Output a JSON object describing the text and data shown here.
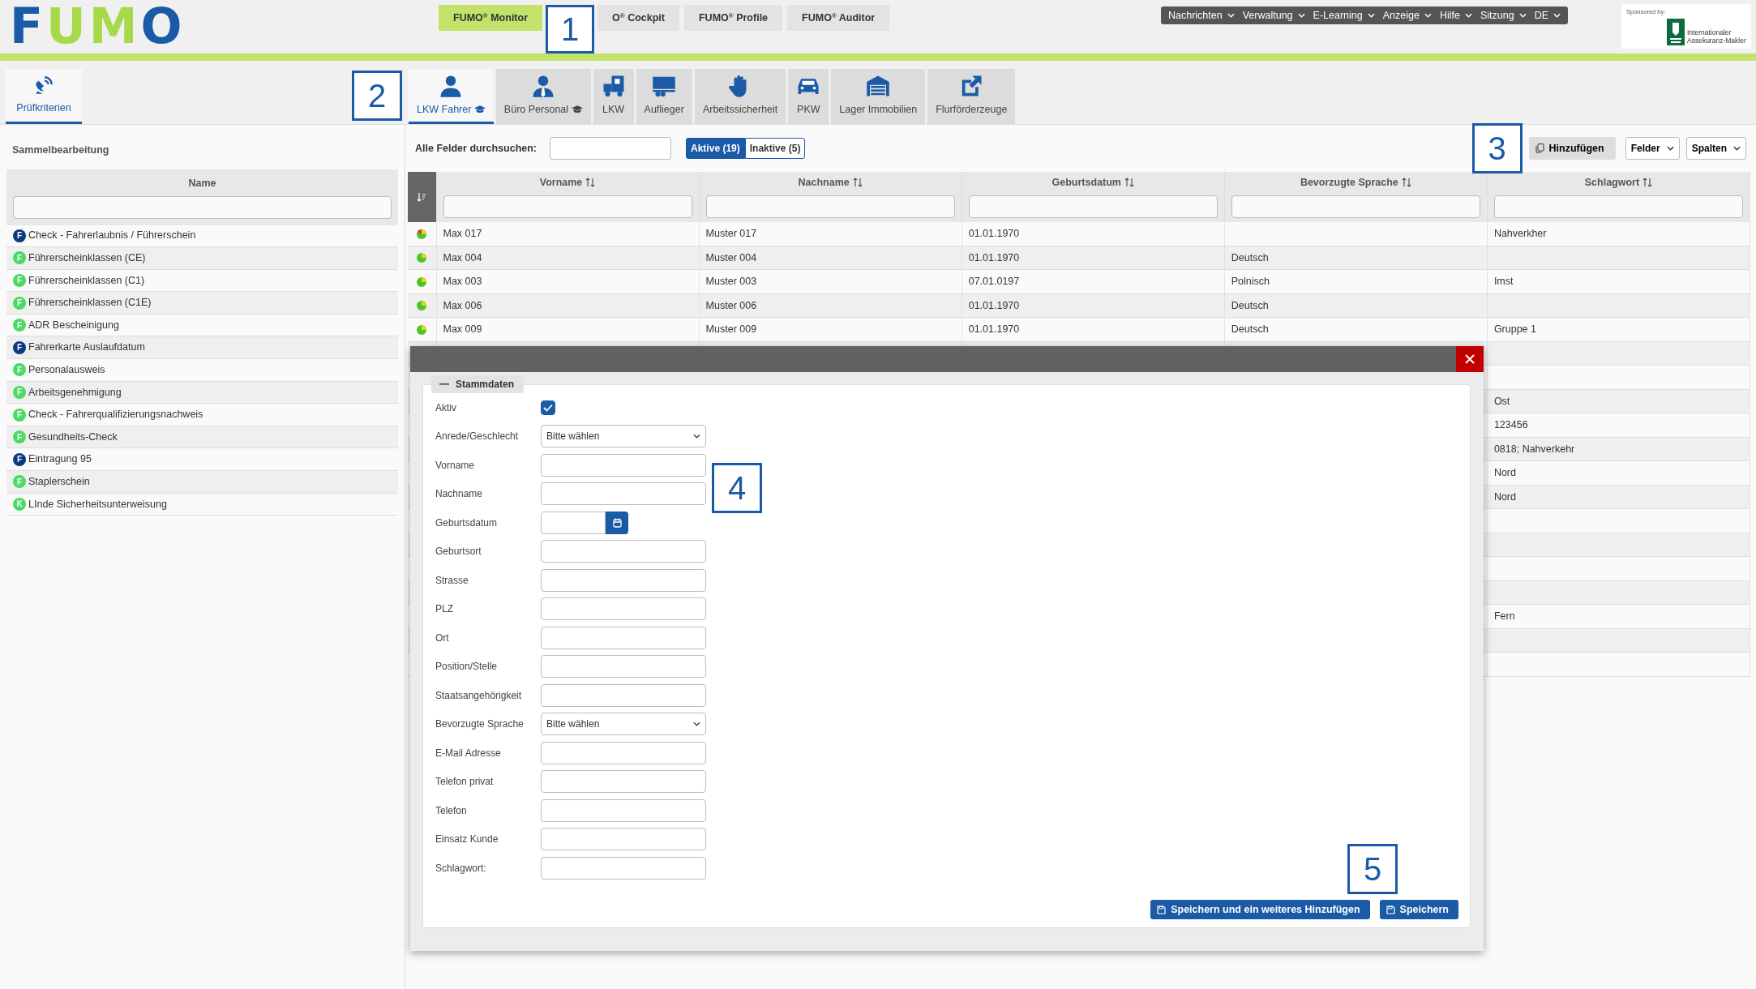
{
  "logo": "FUMO",
  "top_tabs": [
    {
      "label": "FUMO$^{®}$ Monitor",
      "selected": true
    },
    {
      "label": "O$^{®}$ Cockpit",
      "selected": false
    },
    {
      "label": "FUMO$^{®}$ Profile",
      "selected": false
    },
    {
      "label": "FUMO$^{®}$ Auditor",
      "selected": false
    }
  ],
  "menu": [
    "Nachrichten",
    "Verwaltung",
    "E-Learning",
    "Anzeige",
    "Hilfe",
    "Sitzung",
    "DE"
  ],
  "sponsor": {
    "caption": "Sponsored by:",
    "tagline": "Internationaler Assekuranz-Makler"
  },
  "callouts": [
    "1",
    "2",
    "3",
    "4",
    "5"
  ],
  "side_tabs": [
    {
      "label": "Prüfkriterien",
      "selected": true
    }
  ],
  "module_tabs": [
    {
      "label": "LKW Fahrer",
      "cap": true,
      "selected": true
    },
    {
      "label": "Büro Personal",
      "cap": true,
      "selected": false
    },
    {
      "label": "LKW",
      "cap": false,
      "selected": false
    },
    {
      "label": "Auflieger",
      "cap": false,
      "selected": false
    },
    {
      "label": "Arbeitssicherheit",
      "cap": false,
      "selected": false
    },
    {
      "label": "PKW",
      "cap": false,
      "selected": false
    },
    {
      "label": "Lager Immobilien",
      "cap": false,
      "selected": false
    },
    {
      "label": "Flurförderzeuge",
      "cap": false,
      "selected": false
    }
  ],
  "sidebar": {
    "title": "Sammelbearbeitung",
    "column": "Name",
    "items": [
      {
        "badge": "F",
        "color": "#0b3a82",
        "label": "Check - Fahrerlaubnis / Führerschein"
      },
      {
        "badge": "F",
        "color": "#4cd964",
        "label": "Führerscheinklassen (CE)"
      },
      {
        "badge": "F",
        "color": "#4cd964",
        "label": "Führerscheinklassen (C1)"
      },
      {
        "badge": "F",
        "color": "#4cd964",
        "label": "Führerscheinklassen (C1E)"
      },
      {
        "badge": "F",
        "color": "#4cd964",
        "label": "ADR Bescheinigung"
      },
      {
        "badge": "F",
        "color": "#0b3a82",
        "label": "Fahrerkarte Auslaufdatum"
      },
      {
        "badge": "F",
        "color": "#4cd964",
        "label": "Personalausweis"
      },
      {
        "badge": "F",
        "color": "#4cd964",
        "label": "Arbeitsgenehmigung"
      },
      {
        "badge": "F",
        "color": "#4cd964",
        "label": "Check - Fahrerqualifizierungsnachweis"
      },
      {
        "badge": "F",
        "color": "#4cd964",
        "label": "Gesundheits-Check"
      },
      {
        "badge": "F",
        "color": "#0b3a82",
        "label": "Eintragung 95"
      },
      {
        "badge": "F",
        "color": "#4cd964",
        "label": "Staplerschein"
      },
      {
        "badge": "K",
        "color": "#4cd964",
        "label": "LInde Sicherheitsunterweisung"
      }
    ]
  },
  "toolbar": {
    "search_label": "Alle Felder durchsuchen:",
    "filters": [
      {
        "label": "Aktive (19)",
        "selected": true
      },
      {
        "label": "Inaktive (5)",
        "selected": false
      }
    ],
    "buttons": [
      {
        "label": "Hinzufügen",
        "kind": "add"
      },
      {
        "label": "Felder",
        "kind": "dropdown"
      },
      {
        "label": "Spalten",
        "kind": "dropdown"
      }
    ]
  },
  "table": {
    "columns": [
      "Vorname",
      "Nachname",
      "Geburtsdatum",
      "Bevorzugte Sprache",
      "Schlagwort"
    ],
    "rows": [
      {
        "kind": "warning",
        "cells": [
          "Max 017",
          "Muster 017",
          "01.01.1970",
          "",
          "Nahverkher"
        ]
      },
      {
        "kind": "ok",
        "cells": [
          "Max 004",
          "Muster 004",
          "01.01.1970",
          "Deutsch",
          ""
        ]
      },
      {
        "kind": "ok",
        "cells": [
          "Max 003",
          "Muster 003",
          "07.01.0197",
          "Polnisch",
          "Imst"
        ]
      },
      {
        "kind": "ok",
        "cells": [
          "Max 006",
          "Muster 006",
          "01.01.1970",
          "Deutsch",
          ""
        ]
      },
      {
        "kind": "ok",
        "cells": [
          "Max 009",
          "Muster 009",
          "01.01.1970",
          "Deutsch",
          "Gruppe 1"
        ]
      },
      {
        "cells": [
          ""
        ]
      },
      {
        "cells": [
          ""
        ]
      },
      {
        "cells": [
          "Ost"
        ]
      },
      {
        "cells": [
          "123456"
        ]
      },
      {
        "cells": [
          "0818; Nahverkehr"
        ]
      },
      {
        "cells": [
          "Nord"
        ]
      },
      {
        "cells": [
          "Nord"
        ]
      },
      {
        "cells": [
          ""
        ]
      },
      {
        "cells": [
          ""
        ]
      },
      {
        "cells": [
          ""
        ]
      },
      {
        "cells": [
          ""
        ]
      },
      {
        "cells": [
          "Fern"
        ]
      },
      {
        "cells": [
          ""
        ]
      },
      {
        "cells": [
          ""
        ]
      }
    ]
  },
  "modal": {
    "legend": "Stammdaten",
    "fields": [
      {
        "label": "Aktiv",
        "kind": "checkbox",
        "checked": true
      },
      {
        "label": "Anrede/Geschlecht",
        "kind": "select",
        "value": "Bitte wählen"
      },
      {
        "label": "Vorname",
        "kind": "text"
      },
      {
        "label": "Nachname",
        "kind": "text"
      },
      {
        "label": "Geburtsdatum",
        "kind": "date"
      },
      {
        "label": "Geburtsort",
        "kind": "text"
      },
      {
        "label": "Strasse",
        "kind": "text"
      },
      {
        "label": "PLZ",
        "kind": "text"
      },
      {
        "label": "Ort",
        "kind": "text"
      },
      {
        "label": "Position/Stelle",
        "kind": "text"
      },
      {
        "label": "Staatsangehörigkeit",
        "kind": "text"
      },
      {
        "label": "Bevorzugte Sprache",
        "kind": "select",
        "value": "Bitte wählen"
      },
      {
        "label": "E-Mail Adresse",
        "kind": "text"
      },
      {
        "label": "Telefon privat",
        "kind": "text"
      },
      {
        "label": "Telefon",
        "kind": "text"
      },
      {
        "label": "Einsatz Kunde",
        "kind": "text"
      },
      {
        "label": "Schlagwort:",
        "kind": "text"
      }
    ],
    "buttons": [
      "Speichern und ein weiteres Hinzufügen",
      "Speichern"
    ]
  }
}
